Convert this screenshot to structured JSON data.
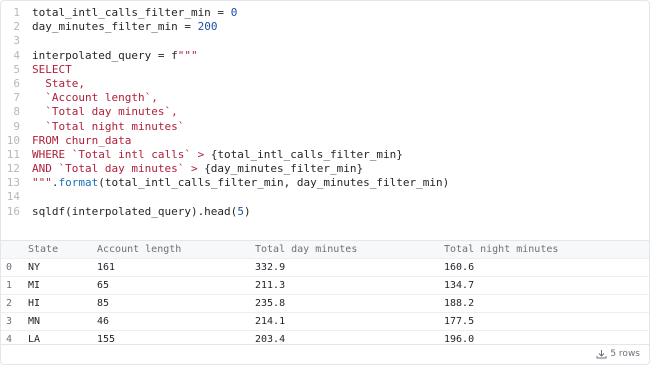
{
  "code": {
    "lines": [
      {
        "n": "1",
        "html": "total_intl_calls_filter_min = <span class=\"num\">0</span>"
      },
      {
        "n": "2",
        "html": "day_minutes_filter_min = <span class=\"num\">200</span>"
      },
      {
        "n": "3",
        "html": ""
      },
      {
        "n": "4",
        "html": "interpolated_query = f<span class=\"str\">\"\"\"</span>"
      },
      {
        "n": "5",
        "html": "<span class=\"str\">SELECT</span>"
      },
      {
        "n": "6",
        "html": "<span class=\"str\">  State,</span>"
      },
      {
        "n": "7",
        "html": "<span class=\"str\">  `Account length`,</span>"
      },
      {
        "n": "8",
        "html": "<span class=\"str\">  `Total day minutes`,</span>"
      },
      {
        "n": "9",
        "html": "<span class=\"str\">  `Total night minutes`</span>"
      },
      {
        "n": "10",
        "html": "<span class=\"str\">FROM churn_data</span>"
      },
      {
        "n": "11",
        "html": "<span class=\"str\">WHERE `Total intl calls` &gt; </span>{total_intl_calls_filter_min}"
      },
      {
        "n": "12",
        "html": "<span class=\"str\">AND `Total day minutes` &gt; </span>{day_minutes_filter_min}"
      },
      {
        "n": "13",
        "html": "<span class=\"str\">\"\"\"</span>.<span class=\"fn\">format</span>(total_intl_calls_filter_min, day_minutes_filter_min)"
      },
      {
        "n": "14",
        "html": ""
      },
      {
        "n": "16",
        "html": "sqldf(interpolated_query).head(<span class=\"num\">5</span>)"
      }
    ]
  },
  "table": {
    "headers": [
      "",
      "State",
      "Account length",
      "Total day minutes",
      "Total night minutes"
    ],
    "rows": [
      [
        "0",
        "NY",
        "161",
        "332.9",
        "160.6"
      ],
      [
        "1",
        "MI",
        "65",
        "211.3",
        "134.7"
      ],
      [
        "2",
        "HI",
        "85",
        "235.8",
        "188.2"
      ],
      [
        "3",
        "MN",
        "46",
        "214.1",
        "177.5"
      ],
      [
        "4",
        "LA",
        "155",
        "203.4",
        "196.0"
      ]
    ]
  },
  "footer": {
    "rows_label": "5 rows",
    "icon": "download-icon"
  }
}
